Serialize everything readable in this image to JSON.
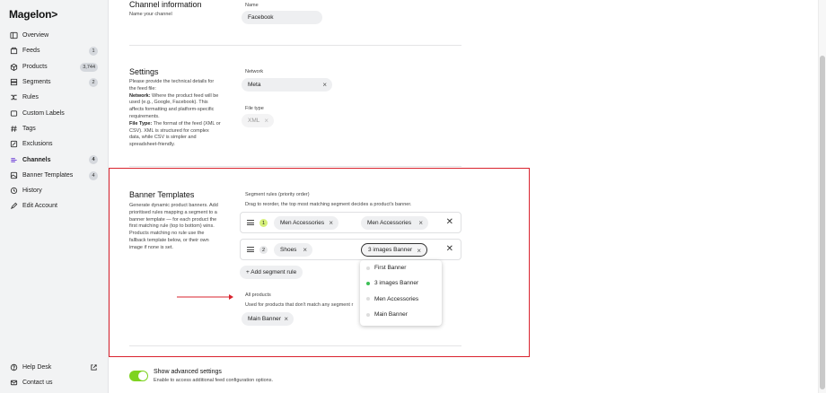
{
  "app": {
    "logo": "Magelon>"
  },
  "sidebar": {
    "items": [
      {
        "label": "Overview",
        "icon": "overview-icon"
      },
      {
        "label": "Feeds",
        "icon": "feeds-icon",
        "badge": "1"
      },
      {
        "label": "Products",
        "icon": "products-icon",
        "badge": "3,744"
      },
      {
        "label": "Segments",
        "icon": "segments-icon",
        "badge": "2"
      },
      {
        "label": "Rules",
        "icon": "rules-icon"
      },
      {
        "label": "Custom Labels",
        "icon": "custom-labels-icon"
      },
      {
        "label": "Tags",
        "icon": "tags-icon"
      },
      {
        "label": "Exclusions",
        "icon": "exclusions-icon"
      },
      {
        "label": "Channels",
        "icon": "channels-icon",
        "badge": "4",
        "active": true
      },
      {
        "label": "Banner Templates",
        "icon": "banner-templates-icon",
        "badge": "4"
      },
      {
        "label": "History",
        "icon": "history-icon"
      },
      {
        "label": "Edit Account",
        "icon": "edit-account-icon"
      }
    ],
    "footer": [
      {
        "label": "Help Desk",
        "icon": "help-icon"
      },
      {
        "label": "Contact us",
        "icon": "contact-icon"
      }
    ]
  },
  "channel_info": {
    "title": "Channel information",
    "desc": "Name your channel",
    "name_label": "Name",
    "name_value": "Facebook"
  },
  "settings": {
    "title": "Settings",
    "desc_intro": "Please provide the technical details for the feed file:",
    "network_term": "Network:",
    "network_desc": " Where the product feed will be used (e.g., Google, Facebook). This affects formatting and platform-specific requirements.",
    "filetype_term": "File Type:",
    "filetype_desc": " The format of the feed (XML or CSV). XML is structured for complex data, while CSV is simpler and spreadsheet-friendly.",
    "network_label": "Network",
    "network_value": "Meta",
    "filetype_label": "File type",
    "filetype_value": "XML"
  },
  "banner_templates": {
    "title": "Banner Templates",
    "desc": "Generate dynamic product banners. Add prioritised rules mapping a segment to a banner template — for each product the first matching rule (top to bottom) wins. Products matching no rule use the fallback template below, or their own image if none is set.",
    "rules_label": "Segment rules (priority order)",
    "rules_help": "Drag to reorder, the top most matching segment decides a product's banner.",
    "rules": [
      {
        "priority": "1",
        "segment": "Men Accessories",
        "banner": "Men Accessories"
      },
      {
        "priority": "2",
        "segment": "Shoes",
        "banner": "3 images Banner"
      }
    ],
    "add_rule_label": "+ Add segment rule",
    "all_products_label": "All products",
    "all_products_help": "Used for products that don't match any segment r",
    "fallback_value": "Main Banner",
    "dropdown_options": [
      {
        "label": "First Banner",
        "selected": false
      },
      {
        "label": "3 images Banner",
        "selected": true
      },
      {
        "label": "Men Accessories",
        "selected": false
      },
      {
        "label": "Main Banner",
        "selected": false
      }
    ]
  },
  "advanced": {
    "label": "Show advanced settings",
    "help": "Enable to access additional feed configuration options.",
    "enabled": true
  },
  "colors": {
    "accent": "#7a4fd8",
    "toggle_on": "#7ed321",
    "highlight_box": "#d9232e",
    "priority_one": "#d6f07a",
    "selected_dot": "#3cbf55"
  }
}
